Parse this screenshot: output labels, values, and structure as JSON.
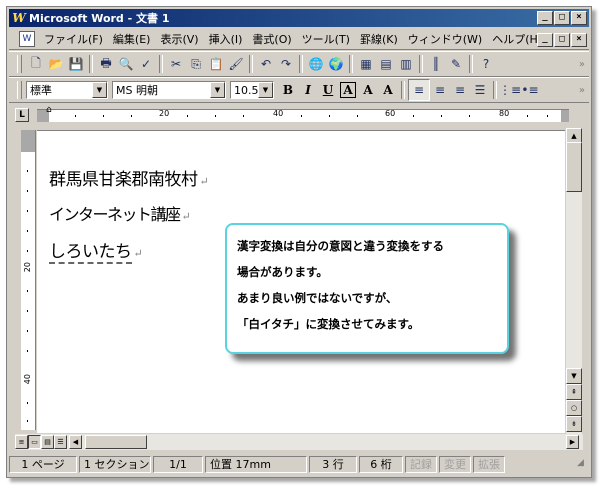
{
  "window": {
    "app_title": "Microsoft Word - 文書 1",
    "app_icon": "W",
    "controls": [
      "_",
      "□",
      "×"
    ]
  },
  "menubar": {
    "items": [
      "ファイル(F)",
      "編集(E)",
      "表示(V)",
      "挿入(I)",
      "書式(O)",
      "ツール(T)",
      "罫線(K)",
      "ウィンドウ(W)",
      "ヘルプ(H)"
    ],
    "doc_controls": [
      "_",
      "□",
      "×"
    ]
  },
  "toolbar_standard": {
    "icons": [
      "new-icon",
      "open-icon",
      "save-icon",
      "print-icon",
      "print-preview-icon",
      "spellcheck-icon",
      "cut-icon",
      "copy-icon",
      "paste-icon",
      "format-painter-icon",
      "undo-icon",
      "redo-icon",
      "hyperlink-icon",
      "web-toolbar-icon",
      "tables-borders-icon",
      "insert-table-icon",
      "insert-excel-icon",
      "columns-icon",
      "drawing-icon",
      "help-icon"
    ],
    "glyphs": {
      "new": "🗋",
      "open": "📂",
      "save": "💾",
      "print": "🖶",
      "preview": "🔍",
      "spell": "✓",
      "cut": "✂",
      "copy": "⎘",
      "paste": "📋",
      "painter": "🖌",
      "undo": "↶",
      "redo": "↷",
      "link": "🌐",
      "web": "🌍",
      "tables": "▦",
      "table": "▤",
      "excel": "▥",
      "columns": "║",
      "drawing": "✎",
      "help": "?"
    }
  },
  "toolbar_format": {
    "style": "標準",
    "font": "MS 明朝",
    "size": "10.5",
    "bold": "B",
    "italic": "I",
    "underline": "U",
    "char_border": "A",
    "char_shading": "A",
    "phonetic": "A"
  },
  "ruler": {
    "corner": "L",
    "numbers": [
      "20",
      "40",
      "60",
      "80"
    ]
  },
  "vruler": {
    "numbers": [
      "20",
      "40"
    ]
  },
  "document": {
    "lines": [
      "群馬県甘楽郡南牧村",
      "インターネット講座",
      "しろいたち"
    ],
    "paragraph_mark": "↵"
  },
  "callout": {
    "lines": [
      "漢字変換は自分の意図と違う変換をする",
      "場合があります。",
      "あまり良い例ではないですが、",
      "「白イタチ」に変換させてみます。"
    ]
  },
  "statusbar": {
    "page": "1 ページ",
    "section": "1 セクション",
    "pages": "1/1",
    "position": "位置 17mm",
    "line": "3 行",
    "column": "6 桁",
    "rec": "記録",
    "trk": "変更",
    "ext": "拡張"
  },
  "colors": {
    "titlebar_start": "#0a246a",
    "titlebar_end": "#3a6ea5",
    "callout_border": "#5ad3e0",
    "chrome": "#d4d0c8"
  }
}
